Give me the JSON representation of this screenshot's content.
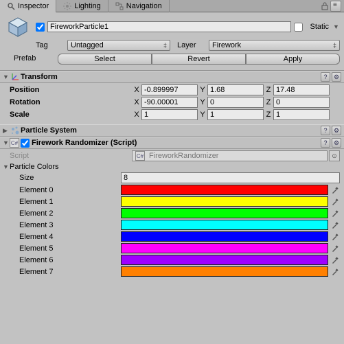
{
  "tabs": {
    "inspector": "Inspector",
    "lighting": "Lighting",
    "navigation": "Navigation"
  },
  "header": {
    "name": "FireworkParticle1",
    "static": "Static",
    "tag_label": "Tag",
    "tag_value": "Untagged",
    "layer_label": "Layer",
    "layer_value": "Firework",
    "prefab_label": "Prefab",
    "select": "Select",
    "revert": "Revert",
    "apply": "Apply"
  },
  "transform": {
    "title": "Transform",
    "position": "Position",
    "rotation": "Rotation",
    "scale": "Scale",
    "px": "-0.899997",
    "py": "1.68",
    "pz": "17.48",
    "rx": "-90.00001",
    "ry": "0",
    "rz": "0",
    "sx": "1",
    "sy": "1",
    "sz": "1",
    "X": "X",
    "Y": "Y",
    "Z": "Z"
  },
  "particle_system": {
    "title": "Particle System"
  },
  "randomizer": {
    "title": "Firework Randomizer (Script)",
    "script_label": "Script",
    "script_value": "FireworkRandomizer",
    "colors_label": "Particle Colors",
    "size_label": "Size",
    "size_value": "8",
    "elements": [
      {
        "label": "Element 0",
        "color": "#ff0000"
      },
      {
        "label": "Element 1",
        "color": "#ffff00"
      },
      {
        "label": "Element 2",
        "color": "#00ff00"
      },
      {
        "label": "Element 3",
        "color": "#00ffff"
      },
      {
        "label": "Element 4",
        "color": "#0000ff"
      },
      {
        "label": "Element 5",
        "color": "#ff00ff"
      },
      {
        "label": "Element 6",
        "color": "#a000ff"
      },
      {
        "label": "Element 7",
        "color": "#ff8000"
      }
    ]
  }
}
